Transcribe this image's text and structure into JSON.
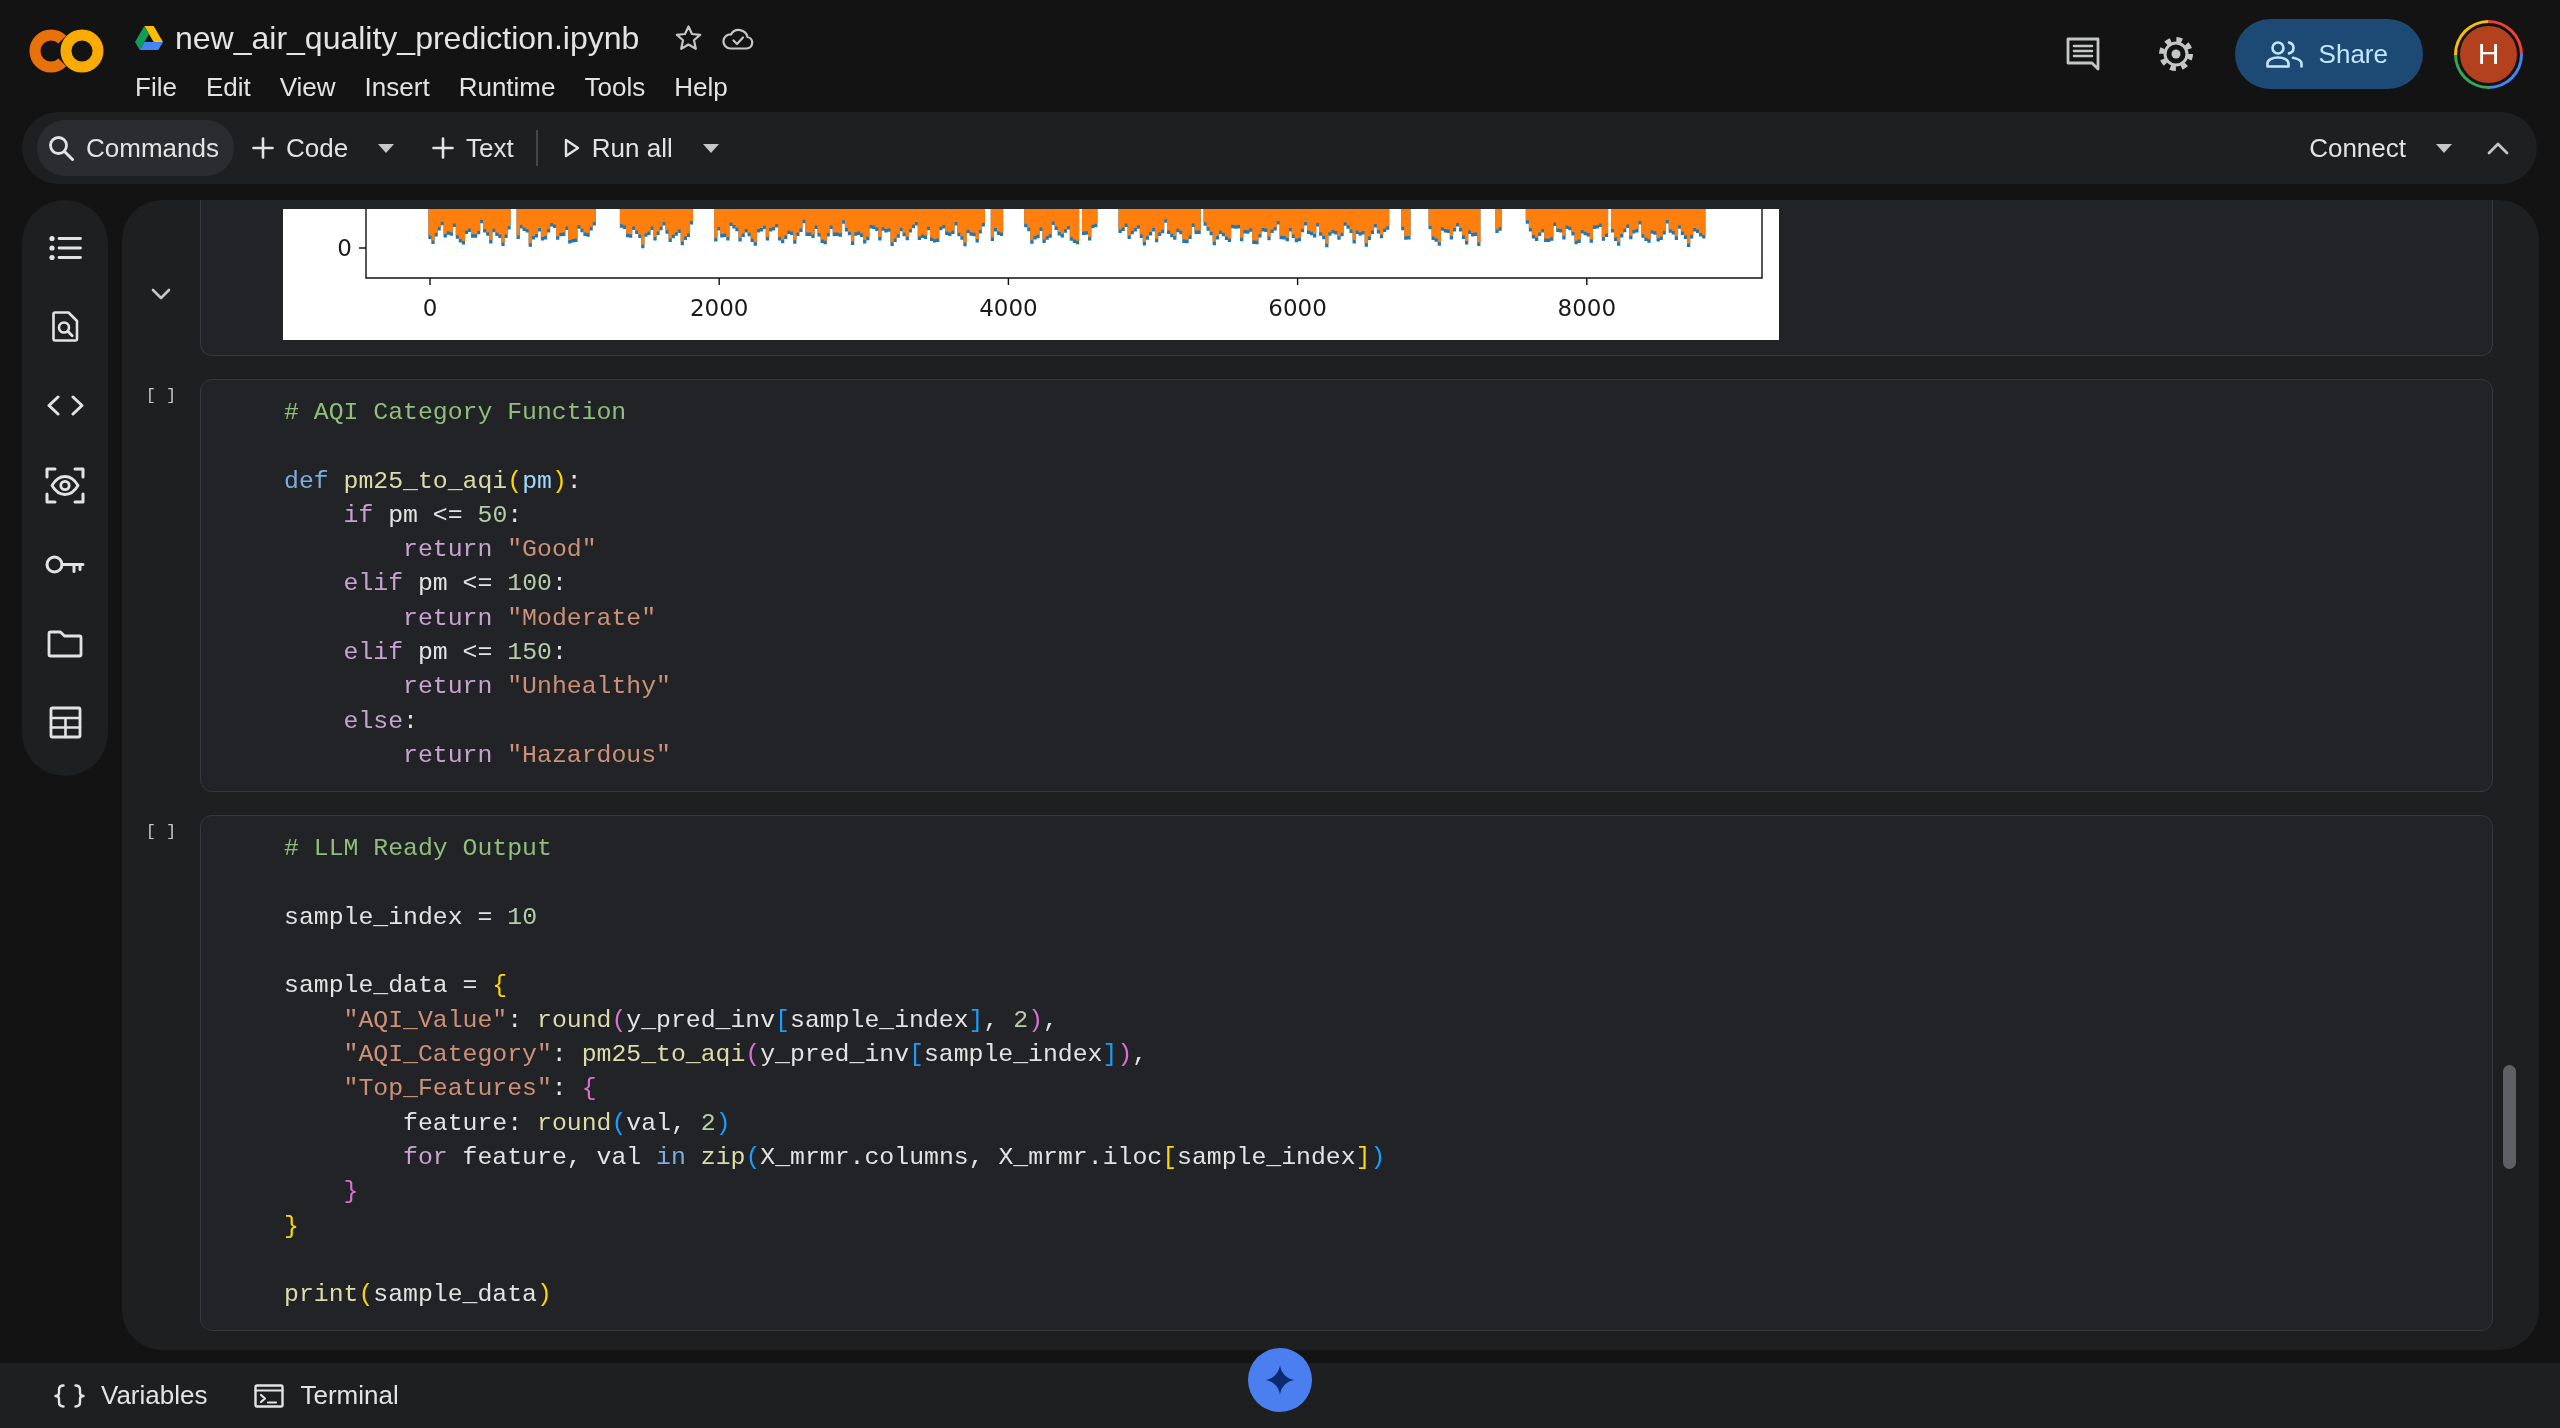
{
  "header": {
    "title": "new_air_quality_prediction.ipynb",
    "menu": [
      "File",
      "Edit",
      "View",
      "Insert",
      "Runtime",
      "Tools",
      "Help"
    ],
    "share": "Share",
    "avatar": "H"
  },
  "toolbar": {
    "items": [
      {
        "kind": "commands",
        "label": "Commands"
      },
      {
        "kind": "code",
        "label": "Code"
      },
      {
        "kind": "text",
        "label": "Text"
      },
      {
        "kind": "run_all",
        "label": "Run all"
      }
    ],
    "connect": "Connect"
  },
  "cells": [
    {
      "kind": "output",
      "plot": {
        "x_tick_labels": [
          "0",
          "2000",
          "4000",
          "6000",
          "8000"
        ],
        "y_tick_labels": [
          "0"
        ]
      }
    },
    {
      "kind": "code",
      "prompt": "[ ]",
      "blocks": [
        [
          "# AQI Category Function"
        ],
        [
          "def pm25_to_aqi(pm):",
          "    if pm <= 50:",
          "        return \"Good\"",
          "    elif pm <= 100:",
          "        return \"Moderate\"",
          "    elif pm <= 150:",
          "        return \"Unhealthy\"",
          "    else:",
          "        return \"Hazardous\""
        ]
      ]
    },
    {
      "kind": "code",
      "prompt": "[ ]",
      "blocks": [
        [
          "# LLM Ready Output"
        ],
        [
          "sample_index = 10"
        ],
        [
          "sample_data = {",
          "    \"AQI_Value\": round(y_pred_inv[sample_index], 2),",
          "    \"AQI_Category\": pm25_to_aqi(y_pred_inv[sample_index]),",
          "    \"Top_Features\": {",
          "        feature: round(val, 2)",
          "        for feature, val in zip(X_mrmr.columns, X_mrmr.iloc[sample_index])",
          "    }",
          "}"
        ],
        [
          "print(sample_data)"
        ]
      ]
    }
  ],
  "bottom_bar": [
    {
      "kind": "variables",
      "label": "Variables"
    },
    {
      "kind": "terminal",
      "label": "Terminal"
    }
  ]
}
